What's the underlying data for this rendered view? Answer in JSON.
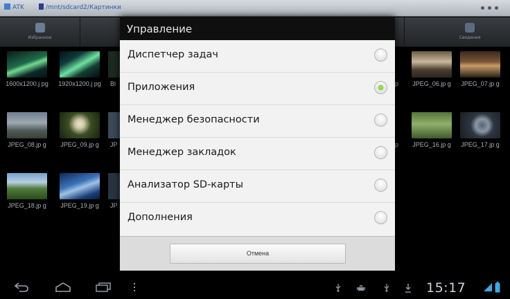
{
  "titlebar": {
    "app_label": "ATK",
    "path": "/mnt/sdcard2/Картинки"
  },
  "toolbar": {
    "buttons": [
      {
        "label": "Избранное"
      },
      {
        "label": ""
      },
      {
        "label": ""
      },
      {
        "label": ""
      },
      {
        "label": ""
      },
      {
        "label": "Сведения"
      }
    ]
  },
  "grid": {
    "tiles": [
      {
        "caption": "1600x1200.j pg"
      },
      {
        "caption": "1920x1200.j pg"
      },
      {
        "caption": "JPEG_06.jp g"
      },
      {
        "caption": "JPEG_07.jp g"
      },
      {
        "caption": "JPEG_08.jp g"
      },
      {
        "caption": "JPEG_09.jp g"
      },
      {
        "caption": "JPEG_16.jp g"
      },
      {
        "caption": "JPEG_17.jp g"
      },
      {
        "caption": "JPEG_18.jp g"
      },
      {
        "caption": "JPEG_19.jp g"
      }
    ],
    "partial_left": [
      "Bl",
      "JP",
      "JP"
    ],
    "partial_right": [
      "p",
      "p"
    ]
  },
  "dialog": {
    "title": "Управление",
    "options": [
      {
        "label": "Диспетчер задач",
        "selected": false
      },
      {
        "label": "Приложения",
        "selected": true
      },
      {
        "label": "Менеджер безопасности",
        "selected": false
      },
      {
        "label": "Менеджер закладок",
        "selected": false
      },
      {
        "label": "Анализатор SD-карты",
        "selected": false
      },
      {
        "label": "Дополнения",
        "selected": false
      }
    ],
    "cancel_label": "Отмена"
  },
  "statusbar": {
    "time": "15:17"
  },
  "colors": {
    "radio_selected": "#5fa81d",
    "dialog_title_bg": "#0f0f0f",
    "accent_blue": "#2d5fa6"
  }
}
